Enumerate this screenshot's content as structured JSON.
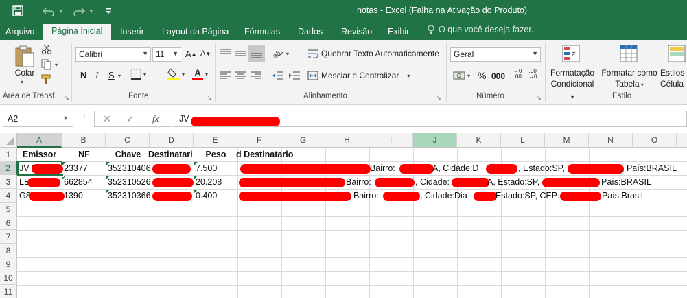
{
  "window": {
    "title": "notas - Excel (Falha na Ativação do Produto)"
  },
  "tabs": [
    "Arquivo",
    "Página Inicial",
    "Inserir",
    "Layout da Página",
    "Fórmulas",
    "Dados",
    "Revisão",
    "Exibir"
  ],
  "tell_me": "O que você deseja fazer...",
  "ribbon": {
    "clipboard": {
      "paste": "Colar",
      "label": "Área de Transf..."
    },
    "font": {
      "name": "Calibri",
      "size": "11",
      "bold": "N",
      "italic": "I",
      "underline": "S",
      "label": "Fonte"
    },
    "alignment": {
      "wrap": "Quebrar Texto Automaticamente",
      "merge": "Mesclar e Centralizar",
      "label": "Alineamento"
    },
    "number": {
      "format": "Geral",
      "label": "Número"
    },
    "styles": {
      "conditional": [
        "Formatação",
        "Condicional"
      ],
      "table": [
        "Formatar como",
        "Tabela"
      ],
      "cell": [
        "Estilos de",
        "Célula"
      ],
      "label": "Estilo"
    }
  },
  "formula_bar": {
    "name_box": "A2",
    "fx": "fx",
    "content": "JV"
  },
  "sheet": {
    "columns": [
      "A",
      "B",
      "C",
      "D",
      "E",
      "F",
      "G",
      "H",
      "I",
      "J",
      "K",
      "L",
      "M",
      "N",
      "O"
    ],
    "rows": [
      "1",
      "2",
      "3",
      "4",
      "5",
      "6",
      "7",
      "8",
      "9",
      "10",
      "11"
    ],
    "header": {
      "emissor": "Emissor",
      "nf": "NF",
      "chave": "Chave",
      "destinatario": "Destinatari",
      "peso": "Peso",
      "end_dest": "d Destinatario"
    },
    "data": [
      {
        "a": "JV D",
        "b": "23377",
        "c": "352310406",
        "e": "7.500",
        "g": ", Bairro:",
        "i": "A, Cidade:D",
        "k": ", Estado:SP,",
        "n": ", País:BRASIL"
      },
      {
        "a": "LE",
        "b": "662854",
        "c": "352310526",
        "e": "20.208",
        "h": "Bairro:",
        "i": ", Cidade:",
        "k": "A, Estado:SP,",
        "n": "País:BRASIL"
      },
      {
        "a": "G8",
        "b": "1390",
        "c": "352310366",
        "e": "0.400",
        "g": ", Bairro:",
        "i": ", Cidade:Dia",
        "k": "Estado:SP, CEP:",
        "n": "País:Brasil"
      }
    ]
  },
  "colors": {
    "excel_green": "#217346",
    "redaction": "#ff0000"
  }
}
